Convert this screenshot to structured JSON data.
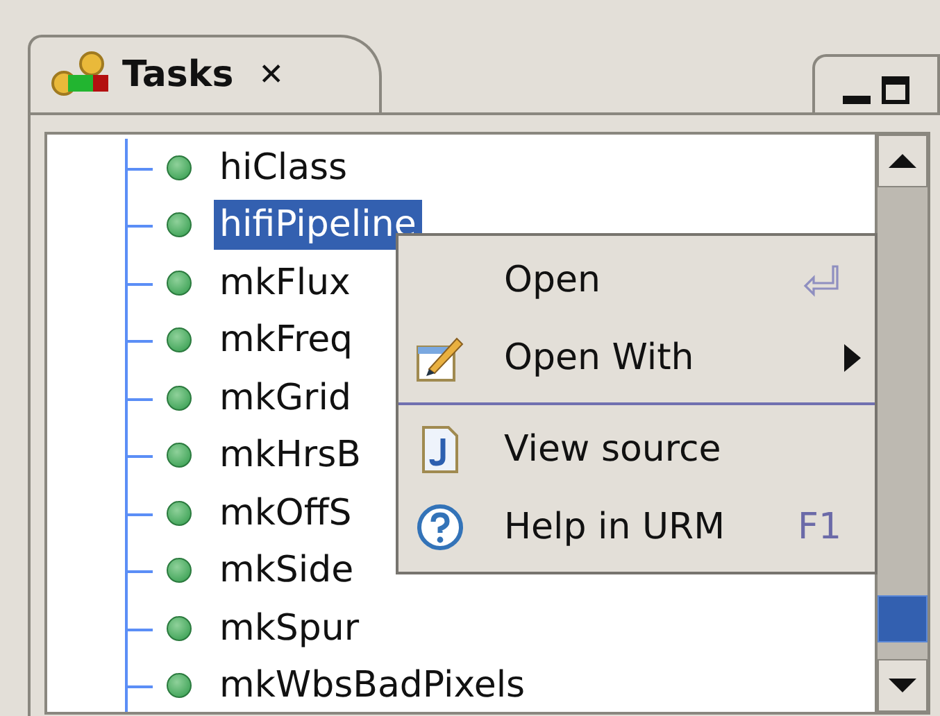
{
  "tab": {
    "title": "Tasks",
    "close": "✕"
  },
  "tree": {
    "items": [
      {
        "label": "hiClass",
        "selected": false
      },
      {
        "label": "hifiPipeline",
        "selected": true
      },
      {
        "label": "mkFlux",
        "selected": false
      },
      {
        "label": "mkFreq",
        "selected": false
      },
      {
        "label": "mkGrid",
        "selected": false
      },
      {
        "label": "mkHrsB",
        "selected": false
      },
      {
        "label": "mkOffS",
        "selected": false
      },
      {
        "label": "mkSide",
        "selected": false
      },
      {
        "label": "mkSpur",
        "selected": false
      },
      {
        "label": "mkWbsBadPixels",
        "selected": false
      }
    ]
  },
  "context_menu": {
    "items": [
      {
        "kind": "item",
        "label": "Open"
      },
      {
        "kind": "submenu",
        "label": "Open With"
      },
      {
        "kind": "separator"
      },
      {
        "kind": "item",
        "label": "View source"
      },
      {
        "kind": "item",
        "label": "Help in URM",
        "shortcut": "F1"
      }
    ]
  }
}
